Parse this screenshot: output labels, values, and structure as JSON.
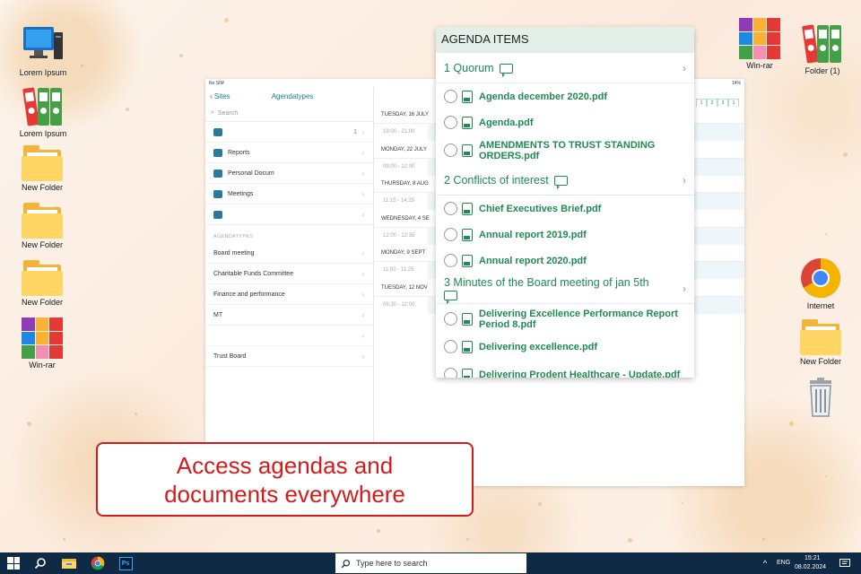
{
  "desktop": {
    "left_icons": [
      {
        "label": "Lorem Ipsum",
        "icon": "computer-icon"
      },
      {
        "label": "Lorem Ipsum",
        "icon": "binders-icon"
      },
      {
        "label": "New Folder",
        "icon": "folder-icon"
      },
      {
        "label": "New Folder",
        "icon": "folder-icon"
      },
      {
        "label": "New Folder",
        "icon": "folder-icon"
      },
      {
        "label": "Win-rar",
        "icon": "winrar-icon"
      }
    ],
    "right_icons": [
      {
        "label": "Win-rar",
        "icon": "winrar-icon"
      },
      {
        "label": "Folder (1)",
        "icon": "binders-icon"
      },
      {
        "label": "Internet",
        "icon": "chrome-icon"
      },
      {
        "label": "New Folder",
        "icon": "folder-icon"
      },
      {
        "label": "",
        "icon": "recycle-bin-icon"
      }
    ]
  },
  "ipad": {
    "status_left": "No SIM",
    "status_right": "14%",
    "back_label": "Sites",
    "nav_title": "Agendatypes",
    "search_placeholder": "Search",
    "top_rows": [
      {
        "label": "",
        "count": "1",
        "icon_color": "#2b7a99"
      },
      {
        "label": "Reports",
        "count": "",
        "icon_color": "#2b7a99"
      },
      {
        "label": "Personal Docum",
        "count": "",
        "icon_color": "#2b7a99"
      },
      {
        "label": "Meetings",
        "count": "",
        "icon_color": "#2b7a99"
      },
      {
        "label": "",
        "count": "",
        "icon_color": "#2b7a99"
      }
    ],
    "section_label": "AGENDATYPES",
    "agendatypes": [
      "Board meeting",
      "Charitable Funds Committee",
      "Finance and performance",
      "MT",
      "",
      "Trust Board"
    ],
    "calendar": [
      {
        "day": "TUESDAY, 16 JULY",
        "time": "19:00 - 21:00"
      },
      {
        "day": "MONDAY, 22 JULY",
        "time": "09:00 - 12:00"
      },
      {
        "day": "THURSDAY, 8 AUG",
        "time": "11:15 - 14:25"
      },
      {
        "day": "WEDNESDAY, 4 SE",
        "time": "12:00 - 12:35"
      },
      {
        "day": "MONDAY, 9 SEPT",
        "time": "11:00 - 11:25"
      },
      {
        "day": "TUESDAY, 12 NOV",
        "time": "09:30 - 12:00"
      }
    ],
    "segments": [
      "1",
      "2",
      "3",
      "1"
    ]
  },
  "agenda": {
    "title": "AGENDA ITEMS",
    "sections": [
      {
        "title": "1 Quorum",
        "docs": [
          "Agenda december 2020.pdf",
          "Agenda.pdf",
          "AMENDMENTS TO TRUST STANDING ORDERS.pdf"
        ]
      },
      {
        "title": "2 Conflicts of interest",
        "docs": [
          "Chief Executives Brief.pdf",
          "Annual report 2019.pdf",
          "Annual report 2020.pdf"
        ]
      },
      {
        "title": "3 Minutes of the Board meeting of jan 5th",
        "docs": [
          "Delivering Excellence Performance Report Period 8.pdf",
          "Delivering excellence.pdf",
          "Delivering Prodent Healthcare - Update.pdf"
        ]
      }
    ]
  },
  "callout": {
    "line1": "Access agendas and",
    "line2": "documents everywhere"
  },
  "taskbar": {
    "search_placeholder": "Type here to search",
    "language": "ENG",
    "time": "15:21",
    "date": "08.02.2024"
  },
  "colors": {
    "agenda_green": "#1f8a52",
    "agenda_header": "#e3efe7",
    "callout_red": "#d21c1c",
    "taskbar": "#0f2a44"
  }
}
